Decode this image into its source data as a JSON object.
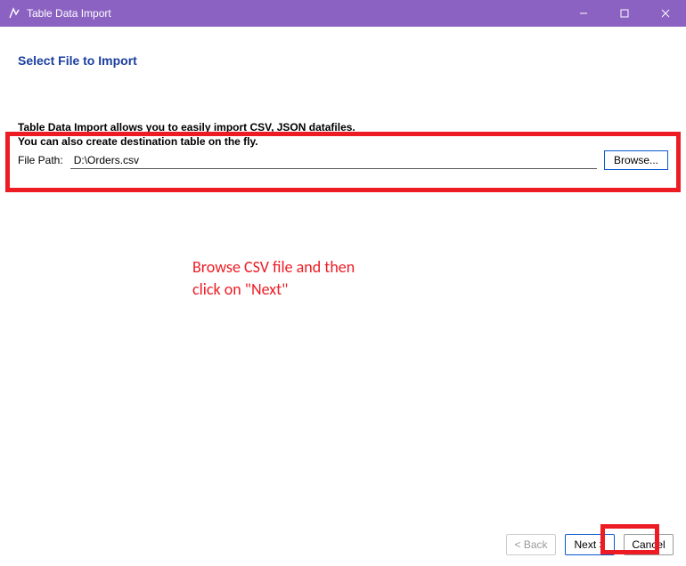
{
  "window": {
    "title": "Table Data Import"
  },
  "page": {
    "heading": "Select File to Import",
    "desc_line1": "Table Data Import allows you to easily import CSV, JSON datafiles.",
    "desc_line2": "You can also create destination table on the fly."
  },
  "filepath": {
    "label": "File Path:",
    "value": "D:\\Orders.csv",
    "browse_label": "Browse..."
  },
  "annotation": {
    "line1": "Browse CSV file and then",
    "line2": "click on \"Next\""
  },
  "footer": {
    "back_label": "< Back",
    "next_label": "Next >",
    "cancel_label": "Cancel"
  }
}
